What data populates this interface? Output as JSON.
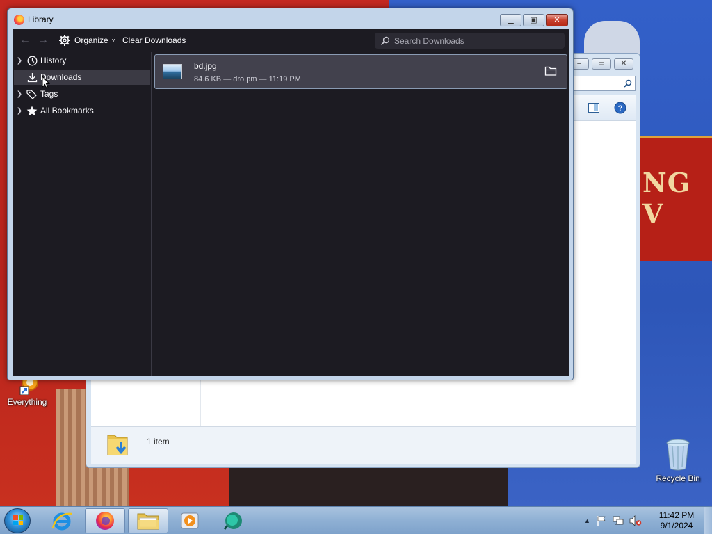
{
  "library": {
    "title": "Library",
    "toolbar": {
      "organize_label": "Organize",
      "clear_downloads_label": "Clear Downloads",
      "search_placeholder": "Search Downloads"
    },
    "sidebar": {
      "items": [
        {
          "label": "History",
          "icon": "clock-icon",
          "expandable": true
        },
        {
          "label": "Downloads",
          "icon": "download-icon",
          "expandable": false,
          "selected": true
        },
        {
          "label": "Tags",
          "icon": "tag-icon",
          "expandable": true
        },
        {
          "label": "All Bookmarks",
          "icon": "star-icon",
          "expandable": true
        }
      ]
    },
    "downloads": [
      {
        "name": "bd.jpg",
        "meta": "84.6 KB — dro.pm — 11:19 PM",
        "icon": "image-thumbnail-icon",
        "action_icon": "folder-icon"
      }
    ]
  },
  "explorer": {
    "status_text": "1 item"
  },
  "desktop": {
    "icons": [
      {
        "label": "Everything",
        "icon": "everything-icon"
      },
      {
        "label": "Recycle Bin",
        "icon": "recycle-bin-icon"
      }
    ],
    "wallpaper_text": "NG V"
  },
  "taskbar": {
    "pinned": [
      {
        "name": "internet-explorer",
        "icon": "ie-icon"
      },
      {
        "name": "firefox",
        "icon": "firefox-icon",
        "active": true
      },
      {
        "name": "file-explorer",
        "icon": "folder-icon",
        "active": true
      },
      {
        "name": "media-player",
        "icon": "media-player-icon"
      },
      {
        "name": "app",
        "icon": "app-icon"
      }
    ],
    "clock": {
      "time": "11:42 PM",
      "date": "9/1/2024"
    }
  },
  "colors": {
    "library_bg": "#1c1b22",
    "selected_row": "#42414d",
    "text": "#fbfbfe",
    "taskbar": "#8fb0d4"
  }
}
